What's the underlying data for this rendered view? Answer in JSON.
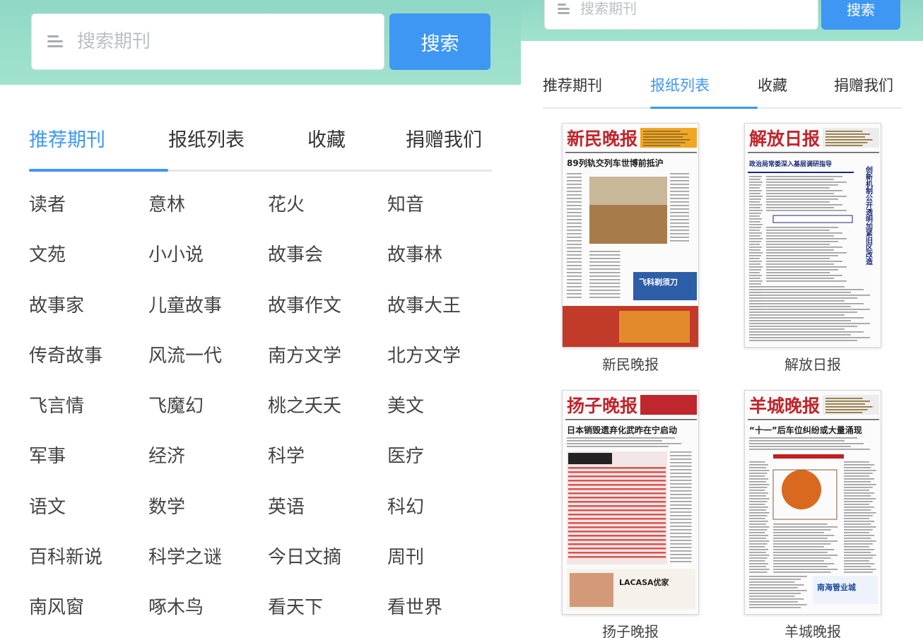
{
  "left_screen": {
    "search": {
      "placeholder": "搜索期刊",
      "button_label": "搜索"
    },
    "tabs": [
      {
        "label": "推荐期刊",
        "active": true
      },
      {
        "label": "报纸列表",
        "active": false
      },
      {
        "label": "收藏",
        "active": false
      },
      {
        "label": "捐赠我们",
        "active": false
      }
    ],
    "magazines": [
      "读者",
      "意林",
      "花火",
      "知音",
      "文苑",
      "小小说",
      "故事会",
      "故事林",
      "故事家",
      "儿童故事",
      "故事作文",
      "故事大王",
      "传奇故事",
      "风流一代",
      "南方文学",
      "北方文学",
      "飞言情",
      "飞魔幻",
      "桃之夭夭",
      "美文",
      "军事",
      "经济",
      "科学",
      "医疗",
      "语文",
      "数学",
      "英语",
      "科幻",
      "百科新说",
      "科学之谜",
      "今日文摘",
      "周刊",
      "南风窗",
      "啄木鸟",
      "看天下",
      "看世界"
    ]
  },
  "right_screen": {
    "search": {
      "placeholder": "搜索期刊",
      "button_label": "搜索"
    },
    "tabs": [
      {
        "label": "推荐期刊",
        "active": false
      },
      {
        "label": "报纸列表",
        "active": true
      },
      {
        "label": "收藏",
        "active": false
      },
      {
        "label": "捐赠我们",
        "active": false
      }
    ],
    "newspapers": [
      {
        "name": "新民晚报",
        "masthead": "新民晚报",
        "headline": "89列轨交列车世博前抵沪",
        "ad_text": "飞科剃须刀"
      },
      {
        "name": "解放日报",
        "masthead": "解放日报",
        "headline": "政治局常委深入基层调研指导",
        "ad_text": "创新机制公开透明加紧旧区改造"
      },
      {
        "name": "扬子晚报",
        "masthead": "扬子晚报",
        "headline": "日本销毁遗弃化武昨在宁启动",
        "ad_text": "LACASA优家"
      },
      {
        "name": "羊城晚报",
        "masthead": "羊城晚报",
        "headline": "“十一”后车位纠纷或大量涌现",
        "ad_text": "南海管业城"
      }
    ]
  },
  "colors": {
    "accent": "#3f97f4",
    "header": "#9adfcb",
    "masthead_red": "#c0262d"
  }
}
